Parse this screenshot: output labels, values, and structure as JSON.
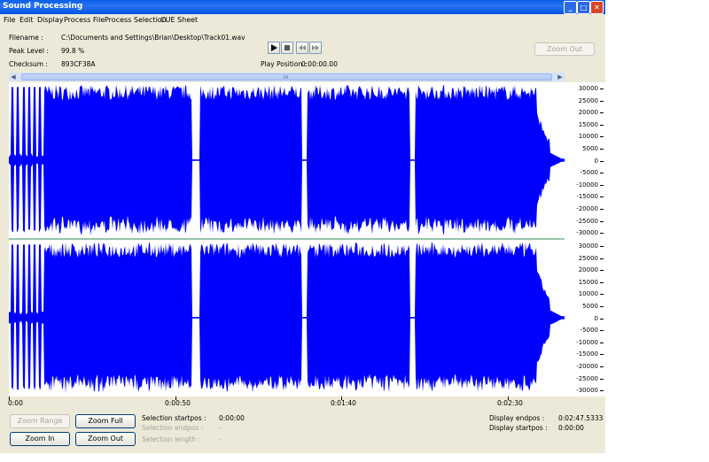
{
  "window": {
    "title": "Sound Processing"
  },
  "title_buttons": {
    "minimize": "_",
    "maximize": "□",
    "close": "✕"
  },
  "menu": [
    "File",
    "Edit",
    "Display",
    "Process File",
    "Process Selection",
    "CUE Sheet"
  ],
  "info": {
    "filename_label": "Filename :",
    "filename_value": "C:\\Documents and Settings\\Brian\\Desktop\\Track01.wav",
    "peak_label": "Peak Level :",
    "peak_value": "99.8 %",
    "checksum_label": "Checksum :",
    "checksum_value": "893CF38A"
  },
  "player": {
    "play_icon": "play-icon",
    "stop_icon": "stop-icon",
    "rewind_icon": "rewind-icon",
    "forward_icon": "fast-forward-icon",
    "position_label": "Play Position :",
    "position_value": "0:00:00.00"
  },
  "zoom_out_top": "Zoom Out",
  "waveform": {
    "color": "#0000ff",
    "divider_color": "#2e8b57",
    "y_ticks": [
      "30000",
      "25000",
      "20000",
      "15000",
      "10000",
      "5000",
      "0",
      "-5000",
      "-10000",
      "-15000",
      "-20000",
      "-25000",
      "-30000"
    ],
    "x_ticks": [
      "0:00",
      "0:00:50",
      "0:01:40",
      "0:02:30"
    ]
  },
  "buttons": {
    "zoom_range": "Zoom Range",
    "zoom_full": "Zoom Full",
    "zoom_in": "Zoom In",
    "zoom_out": "Zoom Out"
  },
  "selection": {
    "startpos_label": "Selection startpos :",
    "startpos_value": "0:00:00",
    "endpos_label": "Selection endpos :",
    "endpos_value": "-",
    "length_label": "Selection length :",
    "length_value": "-"
  },
  "display": {
    "endpos_label": "Display endpos :",
    "endpos_value": "0:02:47.5333",
    "startpos_label": "Display startpos :",
    "startpos_value": "0:00:00"
  }
}
